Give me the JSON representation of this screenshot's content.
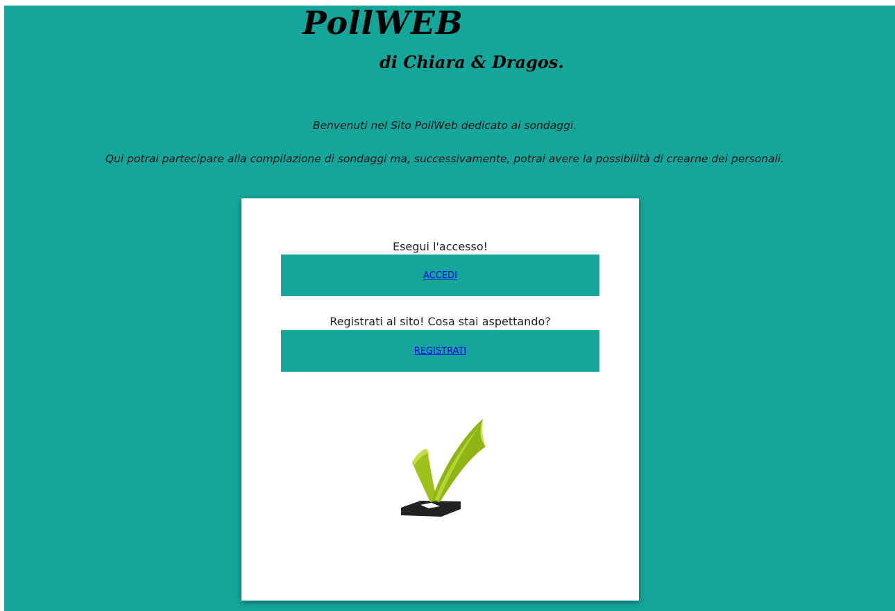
{
  "header": {
    "title": "PollWEB",
    "subtitle": "di Chiara & Dragos."
  },
  "intro": {
    "line1": "Benvenuti nel Sito PollWeb dedicato ai sondaggi.",
    "line2": "Qui potrai partecipare alla compilazione di sondaggi ma, successivamente, potrai avere la possibilità di crearne dei personali."
  },
  "card": {
    "login_prompt": "Esegui l'accesso!",
    "login_link": "ACCEDI",
    "register_prompt": "Registrati al sito! Cosa stai aspettando?",
    "register_link": "REGISTRATI",
    "illustration": "checkmark-vote-icon"
  },
  "colors": {
    "background": "#14a59b",
    "card": "#ffffff",
    "link": "#0000ee",
    "check_green": "#9ec21b",
    "ballot_box": "#222222"
  }
}
